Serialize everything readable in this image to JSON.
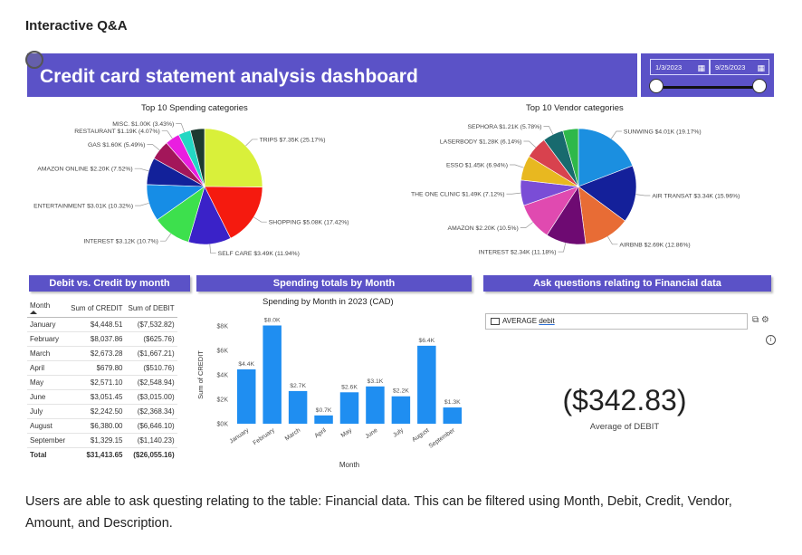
{
  "page": {
    "heading": "Interactive Q&A",
    "description": "Users are able to ask questing relating to the table: Financial data. This can be filtered using Month, Debit, Credit, Vendor, Amount, and Description."
  },
  "dashboard": {
    "title": "Credit card statement analysis dashboard",
    "date_start": "1/3/2023",
    "date_end": "9/25/2023",
    "colors": {
      "banner": "#5b52c7",
      "bar": "#1f8ef1"
    }
  },
  "spending_categories": {
    "title": "Top 10 Spending categories",
    "slices": [
      {
        "label": "TRIPS $7.35K (25.17%)",
        "value": 25.17,
        "color": "#d9f03a"
      },
      {
        "label": "SHOPPING $5.08K (17.42%)",
        "value": 17.42,
        "color": "#f51a0f"
      },
      {
        "label": "SELF CARE $3.49K (11.94%)",
        "value": 11.94,
        "color": "#3a22c8"
      },
      {
        "label": "INTEREST $3.12K (10.7%)",
        "value": 10.7,
        "color": "#3de04d"
      },
      {
        "label": "ENTERTAINMENT $3.01K (10.32%)",
        "value": 10.32,
        "color": "#168de6"
      },
      {
        "label": "AMAZON ONLINE $2.20K (7.52%)",
        "value": 7.52,
        "color": "#12219a"
      },
      {
        "label": "GAS $1.60K (5.49%)",
        "value": 5.49,
        "color": "#a3165a"
      },
      {
        "label": "RESTAURANT $1.19K (4.07%)",
        "value": 4.07,
        "color": "#e91ee0"
      },
      {
        "label": "MISC. $1.00K (3.43%)",
        "value": 3.43,
        "color": "#23d7c3"
      },
      {
        "label": "",
        "value": 3.94,
        "color": "#1d3b30"
      }
    ]
  },
  "vendor_categories": {
    "title": "Top 10 Vendor categories",
    "slices": [
      {
        "label": "SUNWING $4.01K (19.17%)",
        "value": 19.17,
        "color": "#1b8fe0"
      },
      {
        "label": "AIR TRANSAT $3.34K (15.96%)",
        "value": 15.96,
        "color": "#14209a"
      },
      {
        "label": "AIRBNB $2.69K (12.86%)",
        "value": 12.86,
        "color": "#e86c35"
      },
      {
        "label": "INTEREST $2.34K (11.18%)",
        "value": 11.18,
        "color": "#6e0a72"
      },
      {
        "label": "AMAZON $2.20K (10.5%)",
        "value": 10.5,
        "color": "#e04ab0"
      },
      {
        "label": "THE ONE CLINIC $1.49K (7.12%)",
        "value": 7.12,
        "color": "#7a4dd6"
      },
      {
        "label": "ESSO $1.45K (6.94%)",
        "value": 6.94,
        "color": "#e8b820"
      },
      {
        "label": "LASERBODY $1.28K (6.14%)",
        "value": 6.14,
        "color": "#d8424e"
      },
      {
        "label": "SEPHORA $1.21K (5.78%)",
        "value": 5.78,
        "color": "#186a6e"
      },
      {
        "label": "",
        "value": 4.35,
        "color": "#2eb84a"
      }
    ]
  },
  "debit_credit": {
    "header": "Debit vs. Credit by month",
    "columns": [
      "Month",
      "Sum of CREDIT",
      "Sum of DEBIT"
    ],
    "rows": [
      [
        "January",
        "$4,448.51",
        "($7,532.82)"
      ],
      [
        "February",
        "$8,037.86",
        "($625.76)"
      ],
      [
        "March",
        "$2,673.28",
        "($1,667.21)"
      ],
      [
        "April",
        "$679.80",
        "($510.76)"
      ],
      [
        "May",
        "$2,571.10",
        "($2,548.94)"
      ],
      [
        "June",
        "$3,051.45",
        "($3,015.00)"
      ],
      [
        "July",
        "$2,242.50",
        "($2,368.34)"
      ],
      [
        "August",
        "$6,380.00",
        "($6,646.10)"
      ],
      [
        "September",
        "$1,329.15",
        "($1,140.23)"
      ]
    ],
    "total": [
      "Total",
      "$31,413.65",
      "($26,055.16)"
    ]
  },
  "spending_totals": {
    "header": "Spending totals by Month"
  },
  "chart_data": {
    "type": "bar",
    "title": "Spending by Month in 2023 (CAD)",
    "xlabel": "Month",
    "ylabel": "Sum of CREDIT",
    "categories": [
      "January",
      "February",
      "March",
      "April",
      "May",
      "June",
      "July",
      "August",
      "September"
    ],
    "values": [
      4448.51,
      8037.86,
      2673.28,
      679.8,
      2571.1,
      3051.45,
      2242.5,
      6380.0,
      1329.15
    ],
    "data_labels": [
      "$4.4K",
      "$8.0K",
      "$2.7K",
      "$0.7K",
      "$2.6K",
      "$3.1K",
      "$2.2K",
      "$6.4K",
      "$1.3K"
    ],
    "yticks": [
      "$0K",
      "$2K",
      "$4K",
      "$6K",
      "$8K"
    ],
    "ylim": [
      0,
      8000
    ],
    "grid": false
  },
  "qa": {
    "header": "Ask questions relating to Financial data",
    "query_prefix": "AVERAGE ",
    "query_term": "debit",
    "result_value": "($342.83)",
    "result_caption": "Average of DEBIT"
  }
}
